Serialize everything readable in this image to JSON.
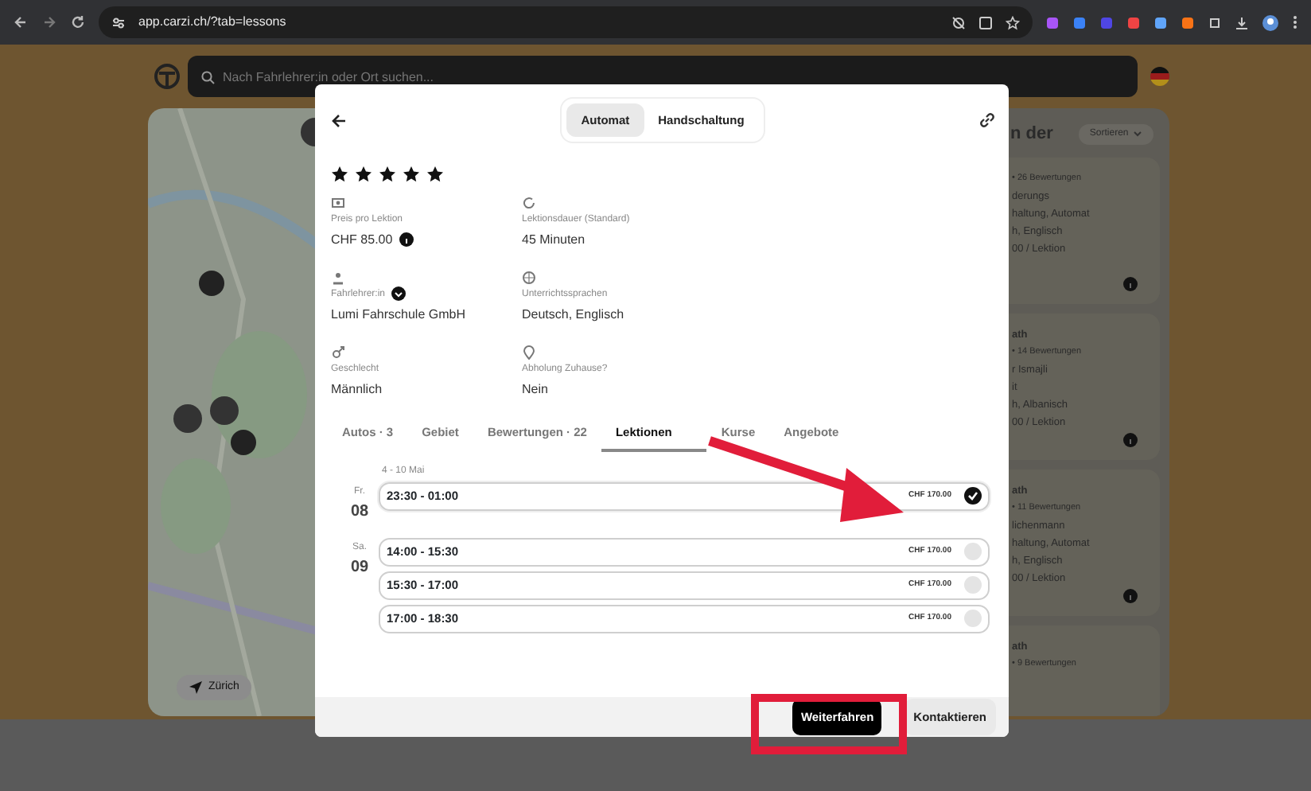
{
  "browser": {
    "url": "app.carzi.ch/?tab=lessons"
  },
  "header": {
    "search": {
      "placeholder": "Nach Fahrlehrer:in oder Ort suchen..."
    }
  },
  "map": {
    "kind": "picture",
    "location_button": "Zürich"
  },
  "list_panel": {
    "heading": "n der",
    "sort_button": "Sortieren",
    "cards": [
      {
        "lines": [
          "• 26 Bewertungen",
          "derungs",
          "haltung, Automat",
          "h, Englisch",
          "00 / Lektion"
        ]
      },
      {
        "title": "ath",
        "lines": [
          "• 14 Bewertungen",
          "r Ismajli",
          "it",
          "h, Albanisch",
          "00 / Lektion"
        ]
      },
      {
        "title": "ath",
        "lines": [
          "• 11 Bewertungen",
          "lichenmann",
          "haltung, Automat",
          "h, Englisch",
          "00 / Lektion"
        ]
      },
      {
        "title": "ath",
        "lines": [
          "• 9 Bewertungen"
        ]
      }
    ]
  },
  "modal": {
    "transmission": [
      {
        "label": "Automat",
        "selected": true
      },
      {
        "label": "Handschaltung",
        "selected": false
      }
    ],
    "stars": 5,
    "info": [
      {
        "kind": "price",
        "label": "Preis pro Lektion",
        "value": "CHF 85.00"
      },
      {
        "kind": "duration",
        "label": "Lektionsdauer (Standard)",
        "value": "45 Minuten"
      },
      {
        "kind": "person",
        "label": "Fahrlehrer:in",
        "value": "Lumi Fahrschule GmbH"
      },
      {
        "kind": "language",
        "label": "Unterrichtssprachen",
        "value": "Deutsch, Englisch"
      },
      {
        "kind": "gender",
        "label": "Geschlecht",
        "value": "Männlich"
      },
      {
        "kind": "pickup",
        "label": "Abholung Zuhause?",
        "value": "Nein"
      }
    ],
    "tabs": [
      {
        "label": "Autos · 3",
        "selected": false
      },
      {
        "label": "Gebiet",
        "selected": false
      },
      {
        "label": "Bewertungen · 22",
        "selected": false
      },
      {
        "label": "Lektionen",
        "selected": true
      },
      {
        "label": "Kurse",
        "selected": false
      },
      {
        "label": "Angebote",
        "selected": false
      }
    ],
    "week": "4 - 10 Mai",
    "days": [
      {
        "weekday": "Fr.",
        "day": "08",
        "slots": [
          {
            "time": "23:30 - 01:00",
            "price": "CHF 170.00",
            "selected": true
          }
        ]
      },
      {
        "weekday": "Sa.",
        "day": "09",
        "slots": [
          {
            "time": "14:00 - 15:30",
            "price": "CHF 170.00",
            "selected": false
          },
          {
            "time": "15:30 - 17:00",
            "price": "CHF 170.00",
            "selected": false
          },
          {
            "time": "17:00 - 18:30",
            "price": "CHF 170.00",
            "selected": false
          }
        ]
      }
    ],
    "buttons": [
      {
        "kind": "primary",
        "label": "Weiterfahren"
      },
      {
        "kind": "secondary",
        "label": "Kontaktieren"
      }
    ]
  }
}
